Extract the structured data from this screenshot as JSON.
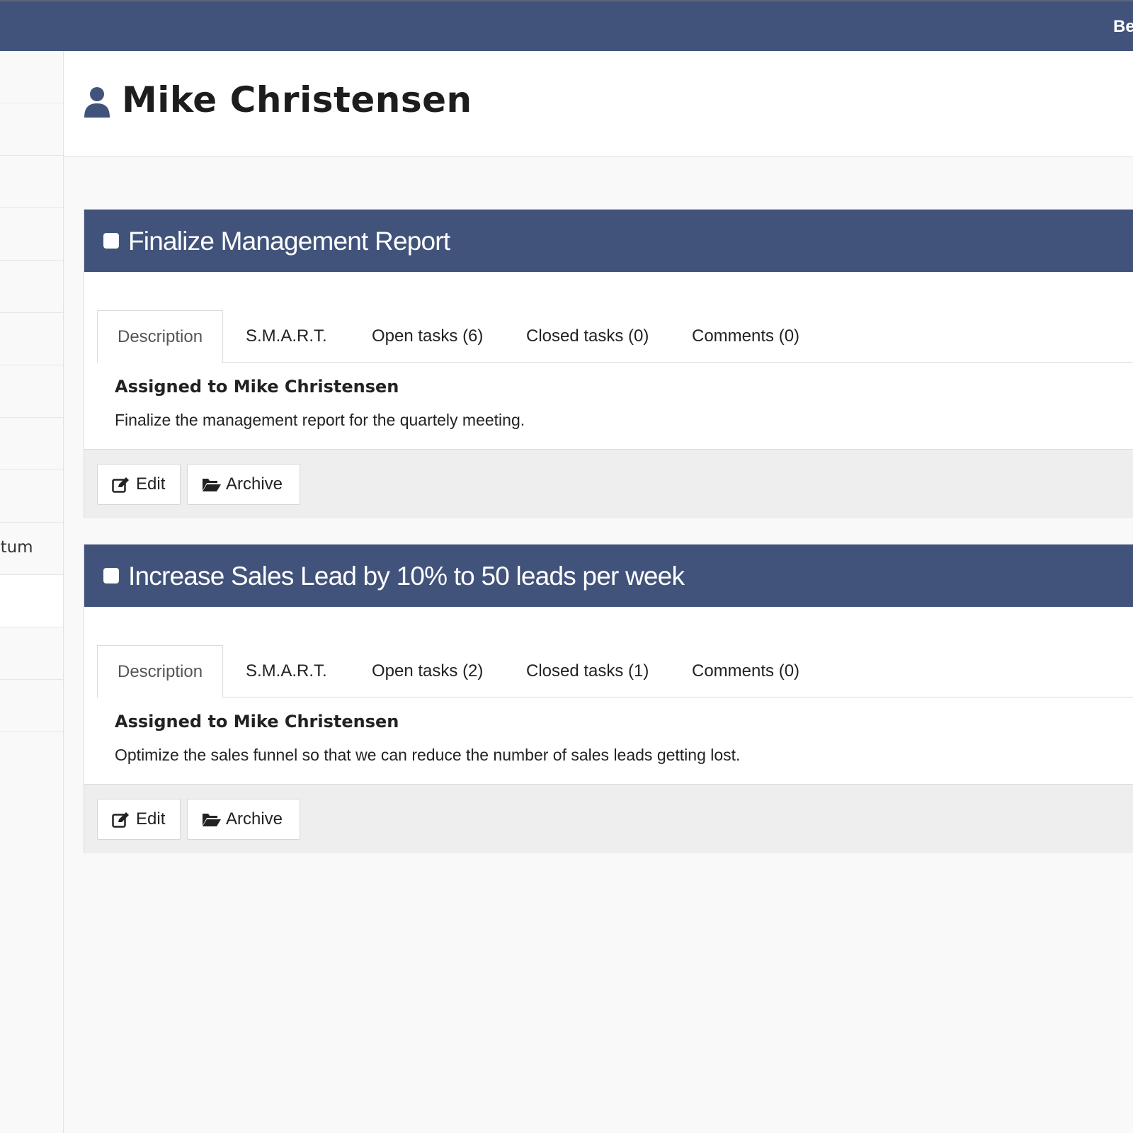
{
  "topbar": {
    "text": "Be"
  },
  "sidebar": {
    "partial_label": "ntum",
    "active_index": 11
  },
  "header": {
    "icon": "user-icon",
    "title": "Mike Christensen"
  },
  "goals": [
    {
      "title": "Finalize Management Report",
      "tabs": [
        "Description",
        "S.M.A.R.T.",
        "Open tasks (6)",
        "Closed tasks (0)",
        "Comments (0)"
      ],
      "active_tab": "Description",
      "assigned": "Assigned to Mike Christensen",
      "description": "Finalize the management report for the quartely meeting.",
      "buttons": {
        "edit": "Edit",
        "archive": "Archive"
      }
    },
    {
      "title": "Increase Sales Lead by 10% to 50 leads per week",
      "tabs": [
        "Description",
        "S.M.A.R.T.",
        "Open tasks (2)",
        "Closed tasks (1)",
        "Comments (0)"
      ],
      "active_tab": "Description",
      "assigned": "Assigned to Mike Christensen",
      "description": "Optimize the sales funnel so that we can reduce the number of sales leads getting lost.",
      "buttons": {
        "edit": "Edit",
        "archive": "Archive"
      }
    }
  ],
  "colors": {
    "brand": "#41537b",
    "background": "#f9f9f9",
    "footer": "#eeeeee"
  }
}
